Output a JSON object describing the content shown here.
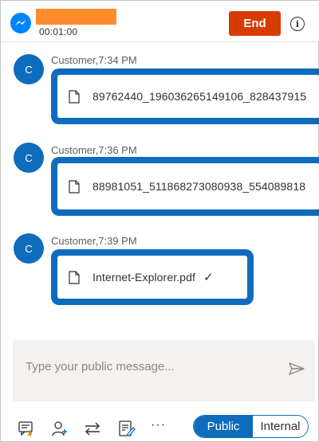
{
  "header": {
    "timer": "00:01:00",
    "end_label": "End",
    "info_icon_glyph": "i"
  },
  "messages": [
    {
      "avatar_initial": "C",
      "sender": "Customer,",
      "time": "7:34 PM",
      "file_name": "89762440_196036265149106_828437915"
    },
    {
      "avatar_initial": "C",
      "sender": "Customer,",
      "time": "7:36 PM",
      "file_name": "88981051_511868273080938_554089818"
    },
    {
      "avatar_initial": "C",
      "sender": "Customer,",
      "time": "7:39 PM",
      "file_name": "Internet-Explorer.pdf",
      "status_glyph": "✓"
    }
  ],
  "composer": {
    "placeholder": "Type your public message..."
  },
  "toolbar": {
    "more_label": "···",
    "mode_public": "Public",
    "mode_internal": "Internal"
  },
  "colors": {
    "brand_blue": "#0f6cbd",
    "end_button": "#d83b01",
    "name_redaction": "#ff8c2a",
    "composer_bg": "#f3f2f1"
  },
  "icons": [
    "messenger-icon",
    "info-icon",
    "file-icon",
    "checkmark-icon",
    "send-icon",
    "quick-replies-icon",
    "add-participant-icon",
    "transfer-icon",
    "notes-icon",
    "more-icon"
  ]
}
